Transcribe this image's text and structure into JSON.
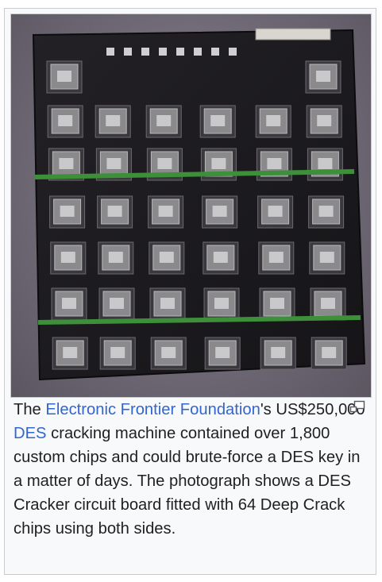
{
  "figure": {
    "image_alt": "DES Cracker circuit board",
    "caption": {
      "pre_link1": "The ",
      "link1": "Electronic Frontier Foundation",
      "post_link1": "'s US$250,000 ",
      "link2": "DES",
      "post_link2": " cracking machine contained over 1,800 custom chips and could brute-force a DES key in a matter of days. The photograph shows a DES Cracker circuit board fitted with 64 Deep Crack chips using both sides."
    },
    "magnify_icon": "enlarge-icon",
    "colors": {
      "link": "#3366cc",
      "text": "#202122",
      "border": "#c8ccd1",
      "board": "#1c1a1f",
      "trace_green": "#3d8f3a"
    }
  }
}
